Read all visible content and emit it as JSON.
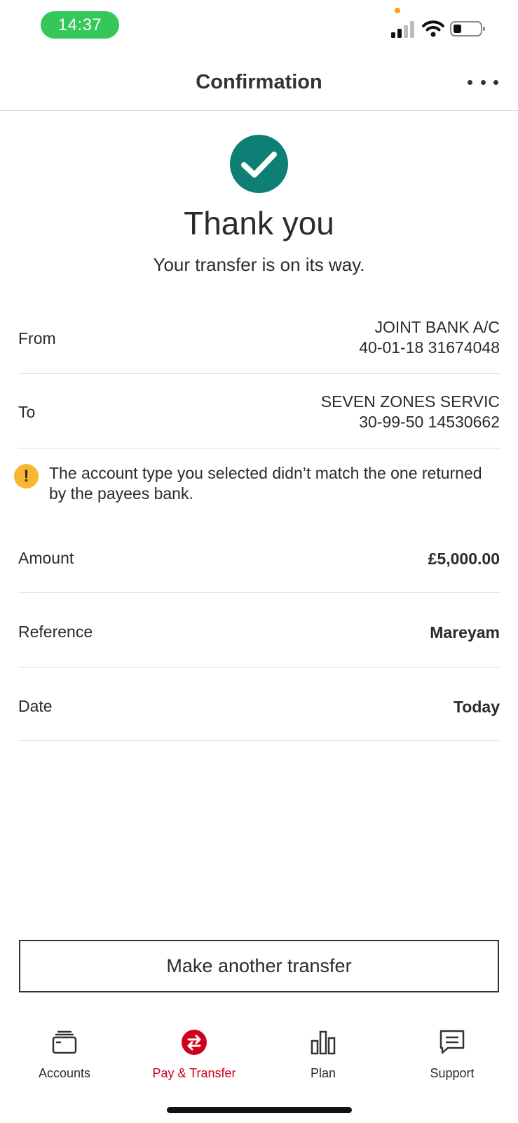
{
  "status_bar": {
    "time": "14:37"
  },
  "header": {
    "title": "Confirmation"
  },
  "success": {
    "title": "Thank you",
    "subtitle": "Your transfer is on its way."
  },
  "transfer": {
    "from": {
      "label": "From",
      "name": "JOINT BANK A/C",
      "account": "40-01-18 31674048"
    },
    "to": {
      "label": "To",
      "name": "SEVEN ZONES SERVIC",
      "account": "30-99-50 14530662"
    },
    "warning": "The account type you selected didn’t match the one returned by the payees bank.",
    "amount": {
      "label": "Amount",
      "value": "£5,000.00"
    },
    "reference": {
      "label": "Reference",
      "value": "Mareyam"
    },
    "date": {
      "label": "Date",
      "value": "Today"
    }
  },
  "actions": {
    "make_another": "Make another transfer"
  },
  "tabs": [
    {
      "label": "Accounts",
      "icon": "wallet-icon",
      "active": false
    },
    {
      "label": "Pay & Transfer",
      "icon": "transfer-icon",
      "active": true
    },
    {
      "label": "Plan",
      "icon": "bar-chart-icon",
      "active": false
    },
    {
      "label": "Support",
      "icon": "chat-icon",
      "active": false
    }
  ],
  "colors": {
    "accent": "#d0021b",
    "success": "#0e7f74",
    "warning": "#f7b731",
    "time_pill": "#34c759"
  }
}
